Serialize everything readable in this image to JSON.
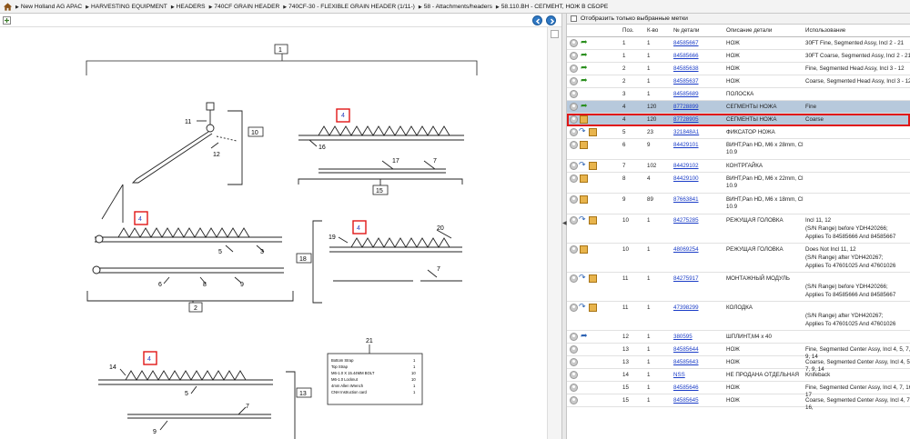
{
  "breadcrumb": [
    "New Holland AG APAC",
    "HARVESTING EQUIPMENT",
    "HEADERS",
    "740CF GRAIN HEADER",
    "740CF-30 - FLEXIBLE GRAIN HEADER (1/11-)",
    "58 - Attachments/headers",
    "58.110.BH - СЕГМЕНТ, НОЖ В СБОРЕ"
  ],
  "filter": {
    "label": "Отобразить только выбранные метки"
  },
  "columns": {
    "pos": "Поз.",
    "qty": "К-во",
    "part": "№ детали",
    "desc": "Описание детали",
    "use": "Использование"
  },
  "colors": {
    "highlight": "#b7c9dc",
    "selection": "#e01616",
    "link": "#1a3cc7"
  },
  "rows": [
    {
      "pos": "1",
      "qty": "1",
      "part": "84585667",
      "desc": "НОЖ",
      "use": [
        "30FT Fine, Segmented Assy, Incl 2 - 21"
      ],
      "icon": "cart-green",
      "style": ""
    },
    {
      "pos": "1",
      "qty": "1",
      "part": "84585666",
      "desc": "НОЖ",
      "use": [
        "30FT Coarse, Segmented Assy, Incl 2 - 21"
      ],
      "icon": "cart-green",
      "style": ""
    },
    {
      "pos": "2",
      "qty": "1",
      "part": "84585638",
      "desc": "НОЖ",
      "use": [
        "Fine, Segmented Head Assy, Incl 3 - 12"
      ],
      "icon": "cart-green",
      "style": ""
    },
    {
      "pos": "2",
      "qty": "1",
      "part": "84585637",
      "desc": "НОЖ",
      "use": [
        "Coarse, Segmented Head Assy, Incl 3 - 12"
      ],
      "icon": "cart-green",
      "style": ""
    },
    {
      "pos": "3",
      "qty": "1",
      "part": "84585689",
      "desc": "ПОЛОСКА",
      "use": [
        ""
      ],
      "icon": "none",
      "style": ""
    },
    {
      "pos": "4",
      "qty": "120",
      "part": "87728899",
      "desc": "СЕГМЕНТЫ НОЖА",
      "use": [
        "Fine"
      ],
      "icon": "cart-green",
      "style": "hl"
    },
    {
      "pos": "4",
      "qty": "120",
      "part": "87728905",
      "desc": "СЕГМЕНТЫ НОЖА",
      "use": [
        "Coarse"
      ],
      "icon": "box",
      "style": "sel"
    },
    {
      "pos": "5",
      "qty": "23",
      "part": "321848A1",
      "desc": "ФИКСАТОР НОЖА",
      "use": [
        ""
      ],
      "icon": "box-blue",
      "style": ""
    },
    {
      "pos": "6",
      "qty": "9",
      "part": "84429101",
      "desc": "ВИНТ,Pan HD, M6 x 28mm, Cl 10.9",
      "use": [
        ""
      ],
      "icon": "box",
      "style": ""
    },
    {
      "pos": "7",
      "qty": "102",
      "part": "84429102",
      "desc": "КОНТРГАЙКА",
      "use": [
        ""
      ],
      "icon": "box-blue",
      "style": ""
    },
    {
      "pos": "8",
      "qty": "4",
      "part": "84429100",
      "desc": "ВИНТ,Pan HD, M6 x 22mm, Cl 10.9",
      "use": [
        ""
      ],
      "icon": "box",
      "style": ""
    },
    {
      "pos": "9",
      "qty": "89",
      "part": "87663841",
      "desc": "ВИНТ,Pan HD, M6 x 18mm, Cl 10.9",
      "use": [
        ""
      ],
      "icon": "box",
      "style": ""
    },
    {
      "pos": "10",
      "qty": "1",
      "part": "84275285",
      "desc": "РЕЖУЩАЯ ГОЛОВКА",
      "use": [
        "Incl 11, 12",
        "(S/N Range) before YDH420266;",
        "Applies To 84585666 And 84585667"
      ],
      "icon": "box-blue",
      "style": ""
    },
    {
      "pos": "10",
      "qty": "1",
      "part": "48069254",
      "desc": "РЕЖУЩАЯ ГОЛОВКА",
      "use": [
        "Does Not Incl 11, 12",
        "(S/N Range) after YDH420267;",
        "Applies To 47601025 And 47601026"
      ],
      "icon": "box",
      "style": ""
    },
    {
      "pos": "11",
      "qty": "1",
      "part": "84275917",
      "desc": "МОНТАЖНЫЙ МОДУЛЬ",
      "use": [
        "",
        "(S/N Range) before YDH420266;",
        "Applies To 84585666 And 84585667"
      ],
      "icon": "box-blue",
      "style": ""
    },
    {
      "pos": "11",
      "qty": "1",
      "part": "47398299",
      "desc": "КОЛОДКА",
      "use": [
        "",
        "(S/N Range) after YDH420267;",
        "Applies To 47601025 And 47601026"
      ],
      "icon": "box-blue",
      "style": ""
    },
    {
      "pos": "12",
      "qty": "1",
      "part": "380595",
      "desc": "ШПЛИНТ,M4 x 40",
      "use": [
        ""
      ],
      "icon": "cart-blue",
      "style": ""
    },
    {
      "pos": "13",
      "qty": "1",
      "part": "84585644",
      "desc": "НОЖ",
      "use": [
        "Fine, Segmented Center Assy, Incl 4, 5, 7, 9, 14"
      ],
      "icon": "none",
      "style": ""
    },
    {
      "pos": "13",
      "qty": "1",
      "part": "84585643",
      "desc": "НОЖ",
      "use": [
        "Coarse, Segmented Center Assy, Incl 4, 5, 7, 9, 14"
      ],
      "icon": "none",
      "style": ""
    },
    {
      "pos": "14",
      "qty": "1",
      "part": "NSS",
      "desc": "НЕ ПРОДАНА ОТДЕЛЬНАЯ",
      "use": [
        "Knifeback"
      ],
      "icon": "none",
      "style": ""
    },
    {
      "pos": "15",
      "qty": "1",
      "part": "84585646",
      "desc": "НОЖ",
      "use": [
        "Fine, Segmented Center Assy, Incl 4, 7, 16, 17"
      ],
      "icon": "none",
      "style": ""
    },
    {
      "pos": "15",
      "qty": "1",
      "part": "84585645",
      "desc": "НОЖ",
      "use": [
        "Coarse, Segmented Center Assy, Incl 4, 7, 16,"
      ],
      "icon": "none",
      "style": ""
    }
  ],
  "diagram": {
    "callouts": [
      "1",
      "10",
      "11",
      "12",
      "16",
      "17",
      "7",
      "15",
      "4",
      "5",
      "3",
      "6",
      "8",
      "9",
      "2",
      "18",
      "19",
      "20",
      "13",
      "14",
      "21"
    ],
    "legend": [
      "Bottom Strap",
      "Top Strap",
      "M6-1.0 X 15.44MM BOLT",
      "M6-1.0 Locknut",
      "4mm Allen Wrench",
      "CNH Instruction card"
    ],
    "legend_qty": [
      "1",
      "1",
      "10",
      "10",
      "1",
      "1"
    ]
  }
}
